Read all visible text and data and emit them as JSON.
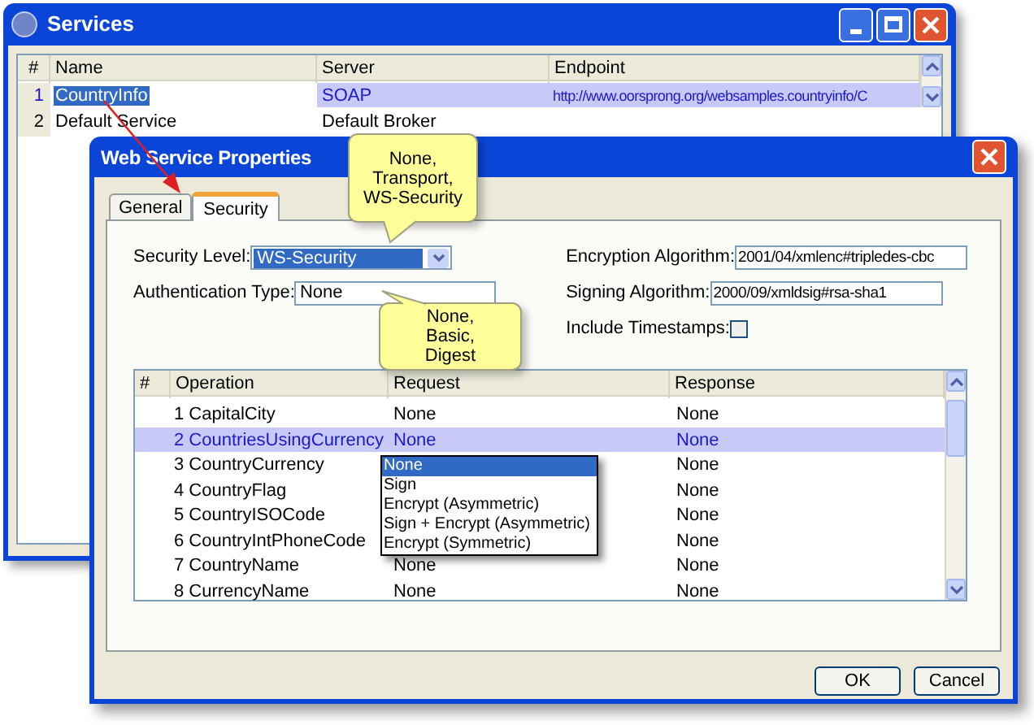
{
  "services_window": {
    "title": "Services",
    "columns": [
      "#",
      "Name",
      "Server",
      "Endpoint"
    ],
    "rows": [
      {
        "number": "1",
        "name": "CountryInfo",
        "server": "SOAP",
        "endpoint": "http://www.oorsprong.org/websamples.countryinfo/C",
        "selected": true
      },
      {
        "number": "2",
        "name": "Default Service",
        "server": "Default Broker",
        "selected": false
      }
    ]
  },
  "dialog": {
    "title": "Web Service Properties",
    "tabs": [
      {
        "label": "General",
        "selected": false
      },
      {
        "label": "Security",
        "selected": true
      }
    ],
    "security_level": {
      "label": "Security Level:",
      "value": "WS-Security"
    },
    "authentication_type": {
      "label": "Authentication Type:",
      "value": "None"
    },
    "encryption_algorithm": {
      "label": "Encryption Algorithm:",
      "value": "2001/04/xmlenc#tripledes-cbc"
    },
    "signing_algorithm": {
      "label": "Signing Algorithm:",
      "value": "2000/09/xmldsig#rsa-sha1"
    },
    "include_timestamps": {
      "label": "Include Timestamps:",
      "checked": false
    },
    "operations": {
      "columns": [
        "#",
        "Operation",
        "Request",
        "Response"
      ],
      "rows": [
        {
          "operation": "1 CapitalCity",
          "request": "None",
          "response": "None",
          "selected": false
        },
        {
          "operation": "2 CountriesUsingCurrency",
          "request": "None",
          "response": "None",
          "selected": true
        },
        {
          "operation": "3 CountryCurrency",
          "response": "None",
          "selected": false
        },
        {
          "operation": "4 CountryFlag",
          "response": "None",
          "selected": false
        },
        {
          "operation": "5 CountryISOCode",
          "response": "None",
          "selected": false
        },
        {
          "operation": "6 CountryIntPhoneCode",
          "response": "None",
          "selected": false
        },
        {
          "operation": "7 CountryName",
          "request": "None",
          "response": "None",
          "selected": false
        },
        {
          "operation": "8 CurrencyName",
          "request": "None",
          "response": "None",
          "selected": false
        }
      ]
    },
    "request_menu": {
      "items": [
        {
          "label": "None",
          "selected": true
        },
        {
          "label": "Sign",
          "selected": false
        },
        {
          "label": "Encrypt (Asymmetric)",
          "selected": false
        },
        {
          "label": "Sign + Encrypt (Asymmetric)",
          "selected": false
        },
        {
          "label": "Encrypt (Symmetric)",
          "selected": false
        }
      ]
    },
    "buttons": [
      "OK",
      "Cancel"
    ]
  },
  "callouts": [
    {
      "lines": [
        "None,",
        "Transport,",
        "WS-Security"
      ]
    },
    {
      "lines": [
        "None,",
        "Basic,",
        "Digest"
      ]
    }
  ]
}
